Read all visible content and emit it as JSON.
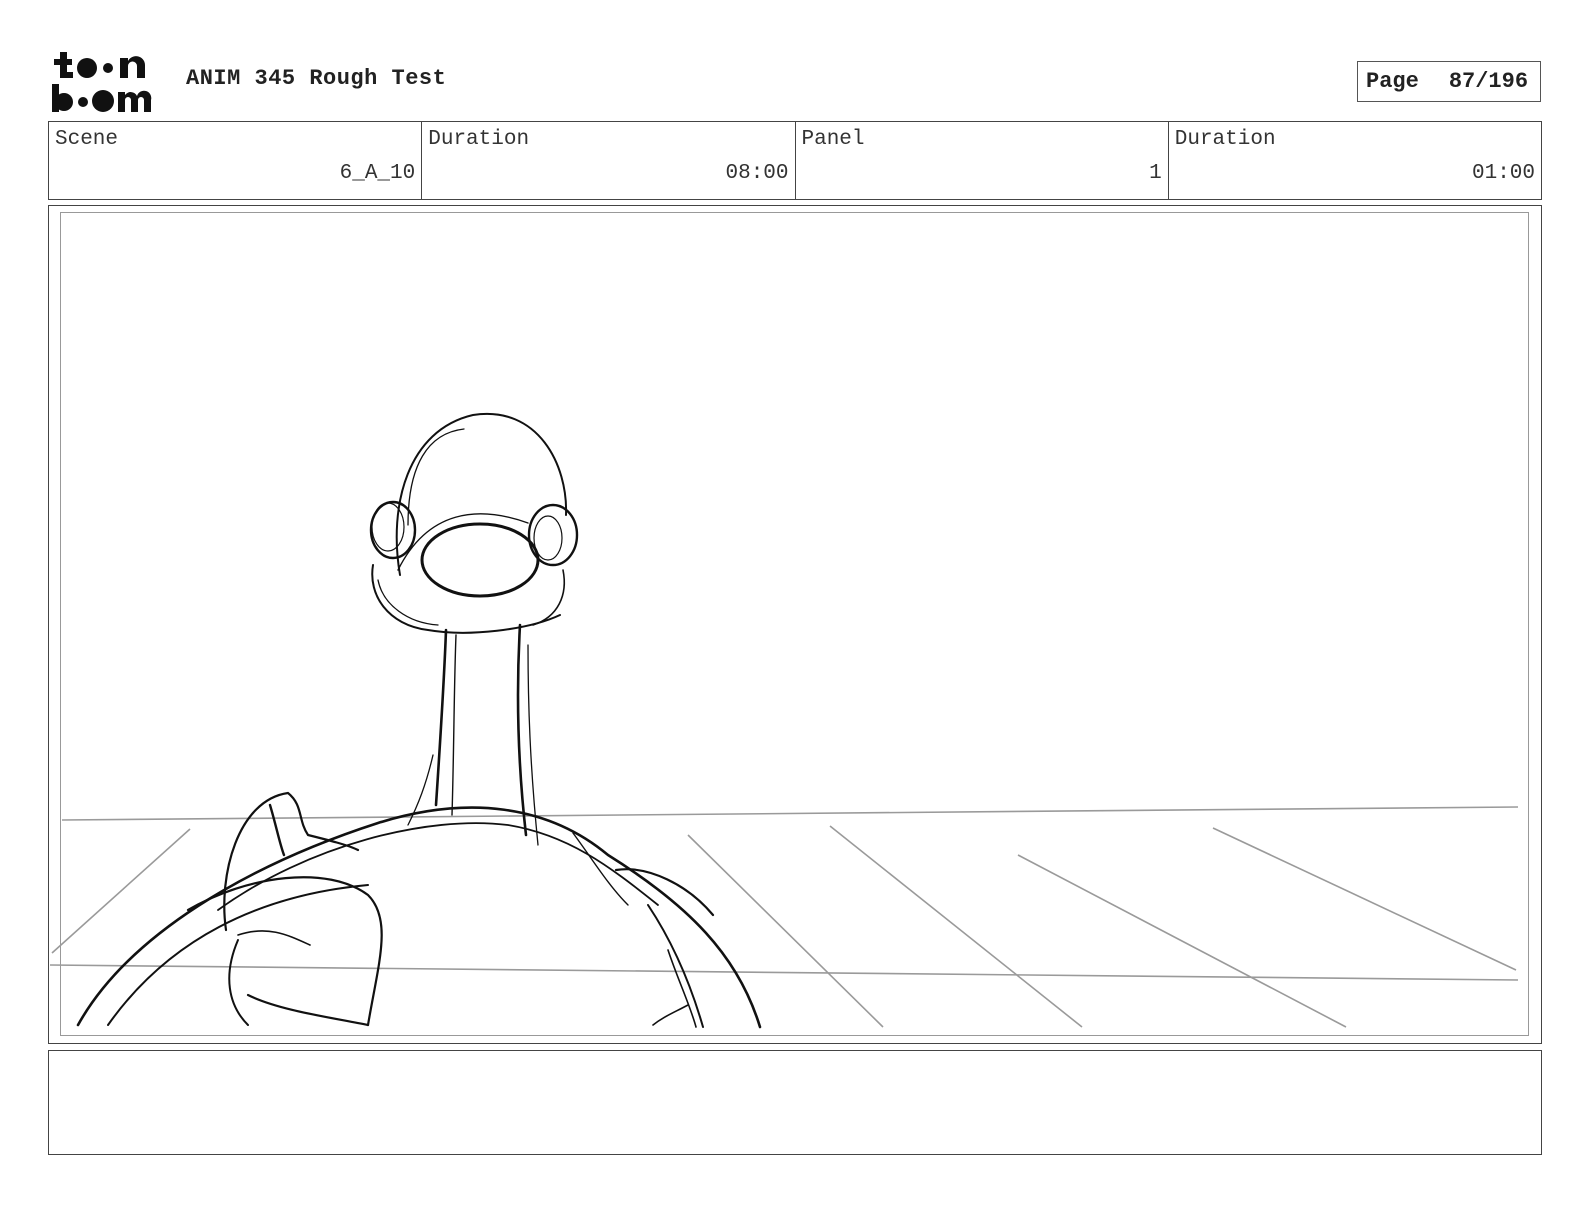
{
  "header": {
    "logo_text": "toonboom",
    "title": "ANIM 345 Rough Test",
    "page_label": "Page",
    "page_value": "87/196"
  },
  "info": {
    "scene_label": "Scene",
    "scene_value": "6_A_10",
    "scene_duration_label": "Duration",
    "scene_duration_value": "08:00",
    "panel_label": "Panel",
    "panel_value": "1",
    "panel_duration_label": "Duration",
    "panel_duration_value": "01:00"
  },
  "panel": {
    "drawing": "rough pencil sketch of a character seen from behind on a perspective floor grid"
  },
  "notes": {
    "text": ""
  }
}
